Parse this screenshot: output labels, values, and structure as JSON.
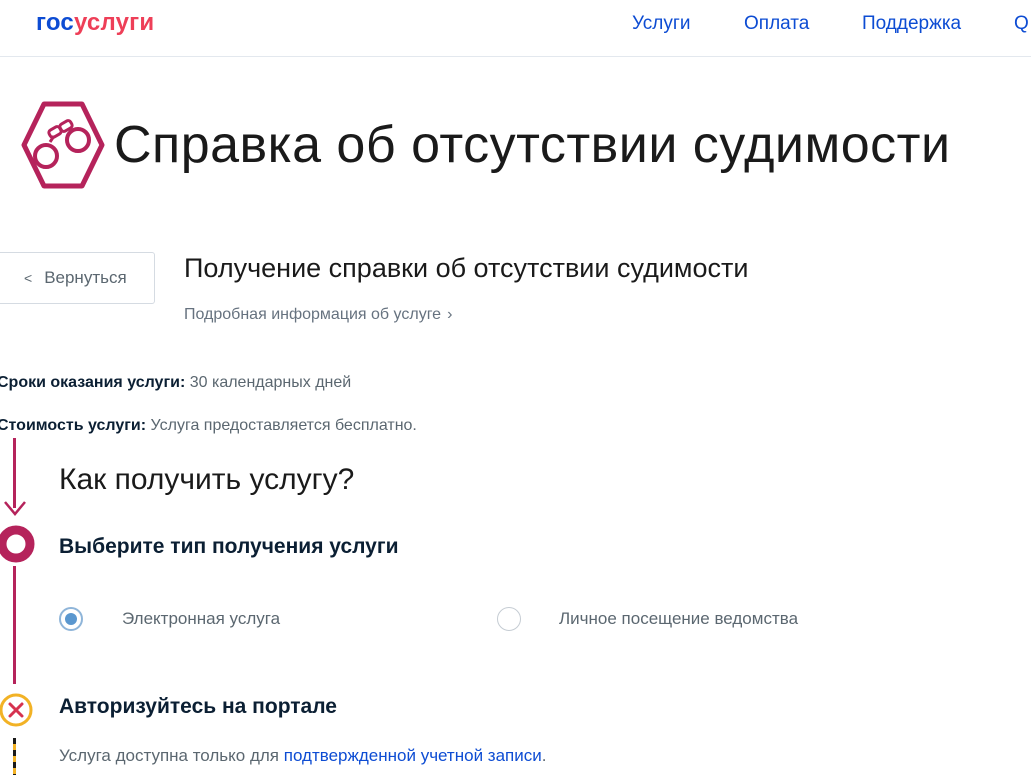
{
  "header": {
    "logo_part1": "гос",
    "logo_part2": "услуги",
    "nav": [
      "Услуги",
      "Оплата",
      "Поддержка"
    ],
    "nav_search_glyph": "Q"
  },
  "page": {
    "title": "Справка об отсутствии судимости",
    "icon": "handcuffs-icon"
  },
  "back_button": {
    "label": "Вернуться"
  },
  "service": {
    "title": "Получение справки об отсутствии судимости",
    "more_link": "Подробная информация об услуге"
  },
  "info": {
    "term_label": "Сроки оказания услуги:",
    "term_value": "30 календарных дней",
    "cost_label": "Стоимость услуги:",
    "cost_value": "Услуга предоставляется бесплатно."
  },
  "how": {
    "title": "Как получить услугу?",
    "step1_title": "Выберите тип получения услуги",
    "options": [
      {
        "label": "Электронная услуга",
        "selected": true
      },
      {
        "label": "Личное посещение ведомства",
        "selected": false
      }
    ],
    "step2_title": "Авторизуйтесь на портале",
    "note_prefix": "Услуга доступна только для ",
    "note_link": "подтвержденной учетной записи",
    "note_suffix": "."
  },
  "colors": {
    "brand_blue": "#0d4cd3",
    "brand_red": "#ee3f58",
    "timeline": "#b5235b",
    "warning": "#f2b225"
  }
}
